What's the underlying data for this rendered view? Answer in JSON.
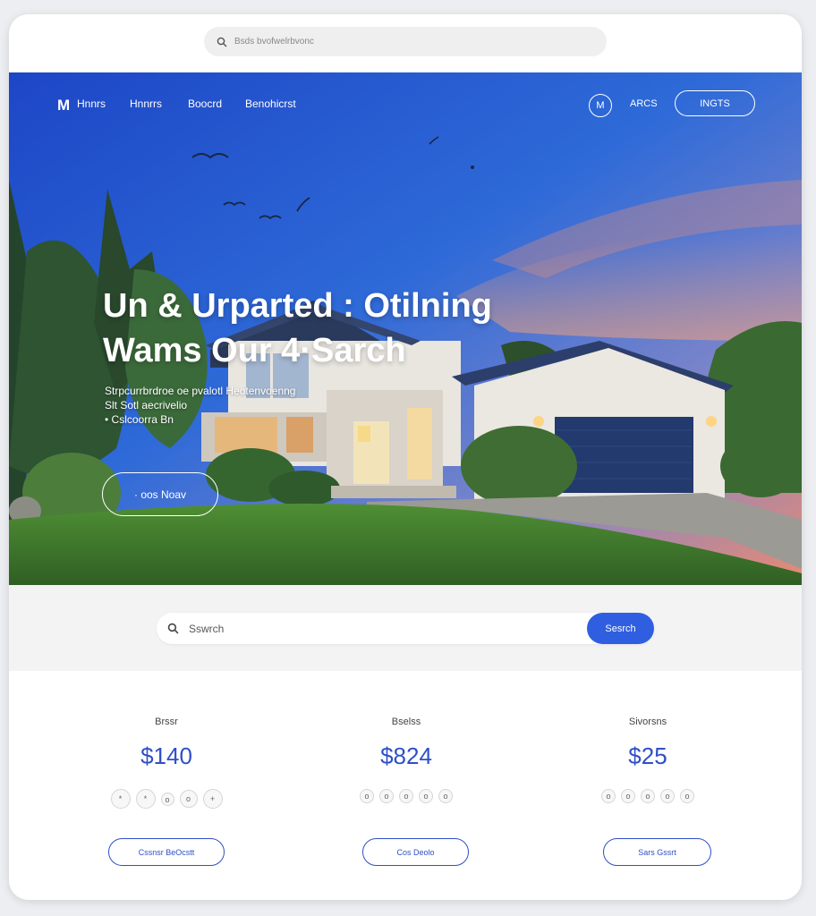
{
  "browser": {
    "url_text": "Bsds bvofwelrbvonc",
    "search_icon": "search-icon"
  },
  "nav": {
    "logo": "M",
    "links": [
      "Hnnrs",
      "Hnnrrs",
      "Boocrd",
      "Benohicrst"
    ],
    "user_icon_letter": "M",
    "about": "ARCS",
    "button": "INGTS"
  },
  "hero": {
    "headline_line1": "Un & Urparted : Otilning",
    "headline_line2": "Wams Our 4·Sarch",
    "sub_line1": "Strpcurrbrdroe oe pvalotl Heotenvoenng",
    "sub_line2": "Slt Sotl aecrivelio",
    "sub_line3": "• Cslcoorra Bn",
    "cta": "· oos Noav"
  },
  "search": {
    "placeholder": "Sswrch",
    "button": "Sesrch"
  },
  "pricing": [
    {
      "label": "Brssr",
      "price": "$140",
      "dots": [
        "*",
        "*",
        "o",
        "o",
        "+"
      ],
      "button": "Cssnsr BeOcstt"
    },
    {
      "label": "Bselss",
      "price": "$824",
      "dots": [
        "o",
        "o",
        "o",
        "o",
        "o"
      ],
      "button": "Cos Deolo"
    },
    {
      "label": "Sivorsns",
      "price": "$25",
      "dots": [
        "o",
        "o",
        "o",
        "o",
        "o"
      ],
      "button": "Sars Gssrt"
    }
  ],
  "colors": {
    "accent": "#2f5fe0",
    "price": "#2f4fc8",
    "sky_top": "#1e4fcf",
    "lawn": "#3f7a2e"
  }
}
